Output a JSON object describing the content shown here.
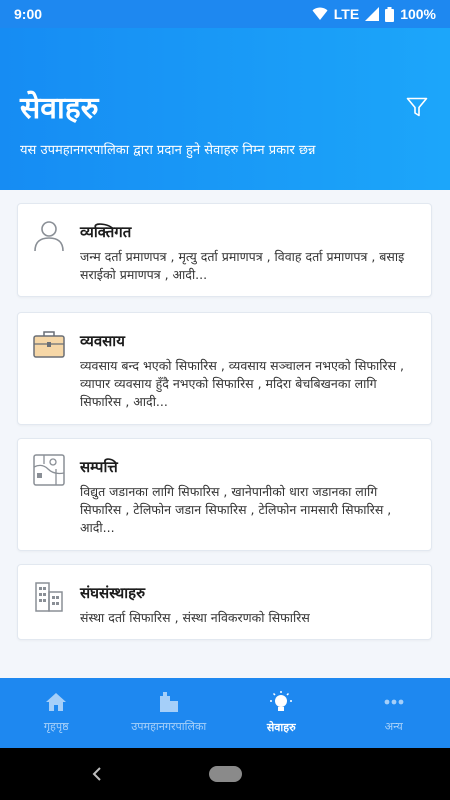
{
  "status_bar": {
    "time": "9:00",
    "network": "LTE",
    "battery": "100%"
  },
  "header": {
    "title": "सेवाहरु",
    "subtitle": "यस उपमहानगरपालिका द्वारा प्रदान हुने सेवाहरु निम्न प्रकार छन्न",
    "filter_icon": "filter-icon"
  },
  "services": [
    {
      "icon": "person-icon",
      "title": "व्यक्तिगत",
      "description": "जन्म दर्ता प्रमाणपत्र , मृत्यु दर्ता प्रमाणपत्र , विवाह दर्ता प्रमाणपत्र , बसाइ सराईको प्रमाणपत्र , आदी..."
    },
    {
      "icon": "briefcase-icon",
      "title": "व्यवसाय",
      "description": "व्यवसाय बन्द भएको सिफारिस , व्यवसाय सञ्चालन नभएको सिफारिस , व्यापार व्यवसाय हुँदै नभएको सिफारिस , मदिरा बेचबिखनका लागि सिफारिस , आदी..."
    },
    {
      "icon": "property-map-icon",
      "title": "सम्पत्ति",
      "description": "विद्युत जडानका लागि सिफारिस , खानेपानीको धारा जडानका लागि सिफारिस , टेलिफोन जडान सिफारिस , टेलिफोन नामसारी सिफारिस , आदी..."
    },
    {
      "icon": "buildings-icon",
      "title": "संघसंस्थाहरु",
      "description": "संस्था दर्ता सिफारिस , संस्था नविकरणको सिफारिस"
    }
  ],
  "bottom_nav": [
    {
      "icon": "home-icon",
      "label": "गृहपृष्ठ",
      "active": false
    },
    {
      "icon": "office-building-icon",
      "label": "उपमहानगरपालिका",
      "active": false
    },
    {
      "icon": "bulb-icon",
      "label": "सेवाहरु",
      "active": true
    },
    {
      "icon": "more-dots-icon",
      "label": "अन्य",
      "active": false
    }
  ],
  "colors": {
    "primary": "#1e88f0",
    "accent_light": "#1ca6fa",
    "background": "#f3f6fb"
  }
}
